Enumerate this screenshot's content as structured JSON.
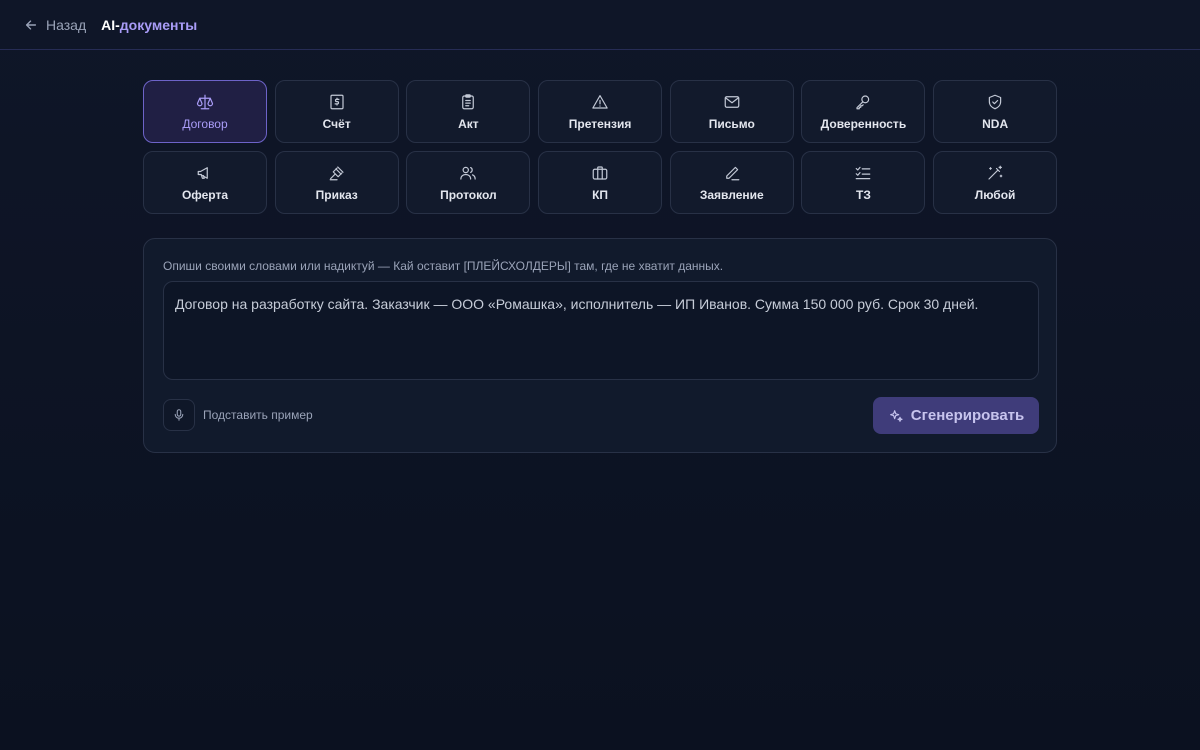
{
  "header": {
    "back_label": "Назад",
    "brand_part1": "AI-",
    "brand_part2": "документы"
  },
  "doc_types": {
    "row1": [
      {
        "label": "Договор",
        "icon": "scales-icon",
        "active": true
      },
      {
        "label": "Счёт",
        "icon": "invoice-icon"
      },
      {
        "label": "Акт",
        "icon": "clipboard-icon"
      },
      {
        "label": "Претензия",
        "icon": "warning-icon"
      },
      {
        "label": "Письмо",
        "icon": "mail-icon"
      },
      {
        "label": "Доверенность",
        "icon": "key-icon"
      },
      {
        "label": "NDA",
        "icon": "shield-check-icon"
      }
    ],
    "row2": [
      {
        "label": "Оферта",
        "icon": "megaphone-icon"
      },
      {
        "label": "Приказ",
        "icon": "gavel-icon"
      },
      {
        "label": "Протокол",
        "icon": "users-icon"
      },
      {
        "label": "КП",
        "icon": "briefcase-icon"
      },
      {
        "label": "Заявление",
        "icon": "pen-icon"
      },
      {
        "label": "ТЗ",
        "icon": "checklist-icon"
      },
      {
        "label": "Любой",
        "icon": "magic-wand-icon"
      }
    ]
  },
  "composer": {
    "hint": "Опиши своими словами или надиктуй — Кай оставит [ПЛЕЙСХОЛДЕРЫ] там, где не хватит данных.",
    "prompt_value": "Договор на разработку сайта. Заказчик — ООО «Ромашка», исполнитель — ИП Иванов. Сумма 150 000 руб. Срок 30 дней.",
    "example_label": "Подставить пример",
    "generate_label": "Сгенерировать"
  },
  "colors": {
    "accent": "#a99cf7",
    "background": "#0c1222",
    "button": "#3f3c7a"
  }
}
